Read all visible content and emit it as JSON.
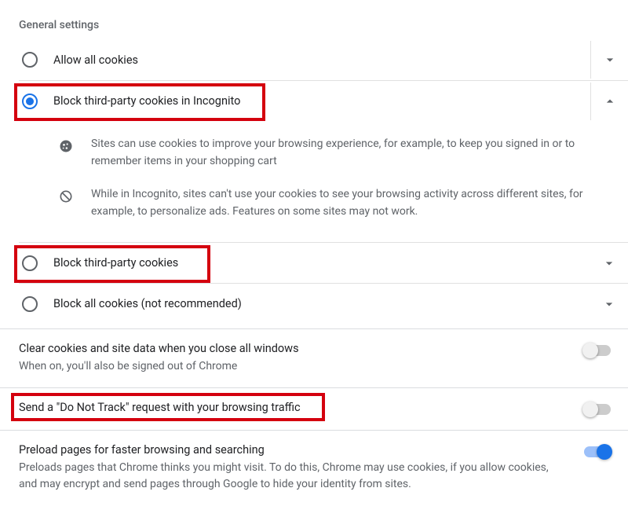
{
  "section_title": "General settings",
  "options": {
    "allow_all": {
      "label": "Allow all cookies",
      "selected": false,
      "expanded": false
    },
    "block_incognito": {
      "label": "Block third-party cookies in Incognito",
      "selected": true,
      "expanded": true,
      "detail1": "Sites can use cookies to improve your browsing experience, for example, to keep you signed in or to remember items in your shopping cart",
      "detail2": "While in Incognito, sites can't use your cookies to see your browsing activity across different sites, for example, to personalize ads. Features on some sites may not work."
    },
    "block_third": {
      "label": "Block third-party cookies",
      "selected": false,
      "expanded": false
    },
    "block_all": {
      "label": "Block all cookies (not recommended)",
      "selected": false,
      "expanded": false
    }
  },
  "toggles": {
    "clear_on_close": {
      "title": "Clear cookies and site data when you close all windows",
      "sub": "When on, you'll also be signed out of Chrome",
      "on": false
    },
    "do_not_track": {
      "title": "Send a \"Do Not Track\" request with your browsing traffic",
      "on": false
    },
    "preload": {
      "title": "Preload pages for faster browsing and searching",
      "sub": "Preloads pages that Chrome thinks you might visit. To do this, Chrome may use cookies, if you allow cookies, and may encrypt and send pages through Google to hide your identity from sites.",
      "on": true
    }
  },
  "highlights": {
    "block_incognito": true,
    "block_third": true,
    "do_not_track": true
  },
  "colors": {
    "accent": "#1a73e8",
    "highlight": "#d4000e"
  }
}
